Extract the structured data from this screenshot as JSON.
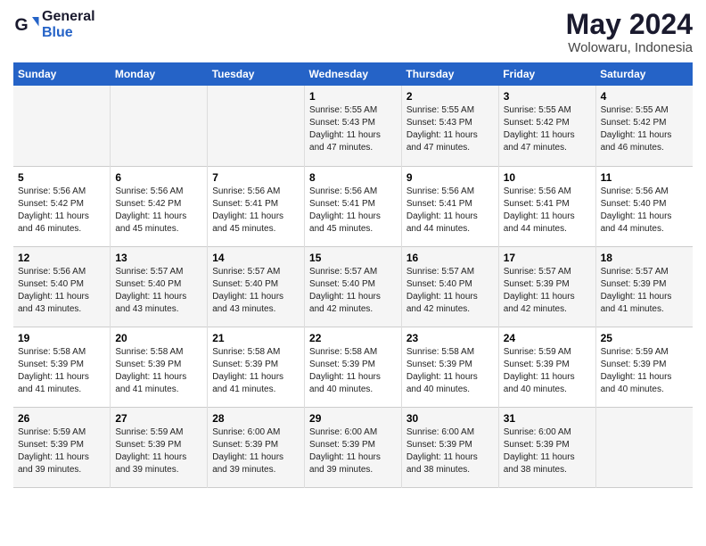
{
  "header": {
    "logo_line1": "General",
    "logo_line2": "Blue",
    "title": "May 2024",
    "subtitle": "Wolowaru, Indonesia"
  },
  "days_of_week": [
    "Sunday",
    "Monday",
    "Tuesday",
    "Wednesday",
    "Thursday",
    "Friday",
    "Saturday"
  ],
  "weeks": [
    [
      {
        "day": "",
        "content": ""
      },
      {
        "day": "",
        "content": ""
      },
      {
        "day": "",
        "content": ""
      },
      {
        "day": "1",
        "content": "Sunrise: 5:55 AM\nSunset: 5:43 PM\nDaylight: 11 hours\nand 47 minutes."
      },
      {
        "day": "2",
        "content": "Sunrise: 5:55 AM\nSunset: 5:43 PM\nDaylight: 11 hours\nand 47 minutes."
      },
      {
        "day": "3",
        "content": "Sunrise: 5:55 AM\nSunset: 5:42 PM\nDaylight: 11 hours\nand 47 minutes."
      },
      {
        "day": "4",
        "content": "Sunrise: 5:55 AM\nSunset: 5:42 PM\nDaylight: 11 hours\nand 46 minutes."
      }
    ],
    [
      {
        "day": "5",
        "content": "Sunrise: 5:56 AM\nSunset: 5:42 PM\nDaylight: 11 hours\nand 46 minutes."
      },
      {
        "day": "6",
        "content": "Sunrise: 5:56 AM\nSunset: 5:42 PM\nDaylight: 11 hours\nand 45 minutes."
      },
      {
        "day": "7",
        "content": "Sunrise: 5:56 AM\nSunset: 5:41 PM\nDaylight: 11 hours\nand 45 minutes."
      },
      {
        "day": "8",
        "content": "Sunrise: 5:56 AM\nSunset: 5:41 PM\nDaylight: 11 hours\nand 45 minutes."
      },
      {
        "day": "9",
        "content": "Sunrise: 5:56 AM\nSunset: 5:41 PM\nDaylight: 11 hours\nand 44 minutes."
      },
      {
        "day": "10",
        "content": "Sunrise: 5:56 AM\nSunset: 5:41 PM\nDaylight: 11 hours\nand 44 minutes."
      },
      {
        "day": "11",
        "content": "Sunrise: 5:56 AM\nSunset: 5:40 PM\nDaylight: 11 hours\nand 44 minutes."
      }
    ],
    [
      {
        "day": "12",
        "content": "Sunrise: 5:56 AM\nSunset: 5:40 PM\nDaylight: 11 hours\nand 43 minutes."
      },
      {
        "day": "13",
        "content": "Sunrise: 5:57 AM\nSunset: 5:40 PM\nDaylight: 11 hours\nand 43 minutes."
      },
      {
        "day": "14",
        "content": "Sunrise: 5:57 AM\nSunset: 5:40 PM\nDaylight: 11 hours\nand 43 minutes."
      },
      {
        "day": "15",
        "content": "Sunrise: 5:57 AM\nSunset: 5:40 PM\nDaylight: 11 hours\nand 42 minutes."
      },
      {
        "day": "16",
        "content": "Sunrise: 5:57 AM\nSunset: 5:40 PM\nDaylight: 11 hours\nand 42 minutes."
      },
      {
        "day": "17",
        "content": "Sunrise: 5:57 AM\nSunset: 5:39 PM\nDaylight: 11 hours\nand 42 minutes."
      },
      {
        "day": "18",
        "content": "Sunrise: 5:57 AM\nSunset: 5:39 PM\nDaylight: 11 hours\nand 41 minutes."
      }
    ],
    [
      {
        "day": "19",
        "content": "Sunrise: 5:58 AM\nSunset: 5:39 PM\nDaylight: 11 hours\nand 41 minutes."
      },
      {
        "day": "20",
        "content": "Sunrise: 5:58 AM\nSunset: 5:39 PM\nDaylight: 11 hours\nand 41 minutes."
      },
      {
        "day": "21",
        "content": "Sunrise: 5:58 AM\nSunset: 5:39 PM\nDaylight: 11 hours\nand 41 minutes."
      },
      {
        "day": "22",
        "content": "Sunrise: 5:58 AM\nSunset: 5:39 PM\nDaylight: 11 hours\nand 40 minutes."
      },
      {
        "day": "23",
        "content": "Sunrise: 5:58 AM\nSunset: 5:39 PM\nDaylight: 11 hours\nand 40 minutes."
      },
      {
        "day": "24",
        "content": "Sunrise: 5:59 AM\nSunset: 5:39 PM\nDaylight: 11 hours\nand 40 minutes."
      },
      {
        "day": "25",
        "content": "Sunrise: 5:59 AM\nSunset: 5:39 PM\nDaylight: 11 hours\nand 40 minutes."
      }
    ],
    [
      {
        "day": "26",
        "content": "Sunrise: 5:59 AM\nSunset: 5:39 PM\nDaylight: 11 hours\nand 39 minutes."
      },
      {
        "day": "27",
        "content": "Sunrise: 5:59 AM\nSunset: 5:39 PM\nDaylight: 11 hours\nand 39 minutes."
      },
      {
        "day": "28",
        "content": "Sunrise: 6:00 AM\nSunset: 5:39 PM\nDaylight: 11 hours\nand 39 minutes."
      },
      {
        "day": "29",
        "content": "Sunrise: 6:00 AM\nSunset: 5:39 PM\nDaylight: 11 hours\nand 39 minutes."
      },
      {
        "day": "30",
        "content": "Sunrise: 6:00 AM\nSunset: 5:39 PM\nDaylight: 11 hours\nand 38 minutes."
      },
      {
        "day": "31",
        "content": "Sunrise: 6:00 AM\nSunset: 5:39 PM\nDaylight: 11 hours\nand 38 minutes."
      },
      {
        "day": "",
        "content": ""
      }
    ]
  ]
}
